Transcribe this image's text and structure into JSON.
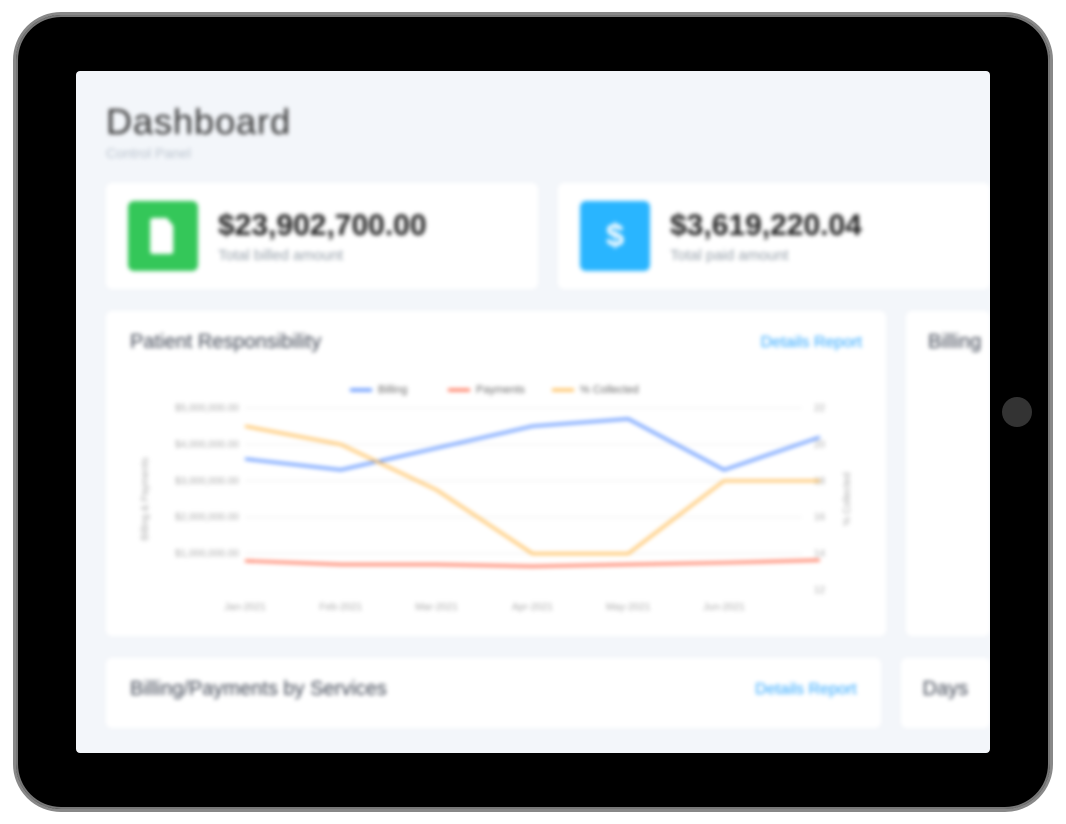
{
  "page": {
    "title": "Dashboard",
    "subtitle": "Control Panel"
  },
  "stats": [
    {
      "value": "$23,902,700.00",
      "label": "Total billed amount",
      "icon": "file-icon",
      "color": "#34c759"
    },
    {
      "value": "$3,619,220.04",
      "label": "Total paid amount",
      "icon": "dollar-icon",
      "color": "#29b5ff"
    }
  ],
  "cards": {
    "patient_responsibility": {
      "title": "Patient Responsibility",
      "link_label": "Details Report"
    },
    "billing_cut": {
      "title": "Billing"
    },
    "billing_services": {
      "title": "Billing/Payments by Services",
      "link_label": "Details Report"
    },
    "days_cut": {
      "title": "Days"
    }
  },
  "chart_data": {
    "type": "line",
    "categories": [
      "Jan-2021",
      "Feb-2021",
      "Mar-2021",
      "Apr-2021",
      "May-2021",
      "Jun-2021"
    ],
    "series": [
      {
        "name": "Billing",
        "axis": "left",
        "color": "#3a7bff",
        "values": [
          3600000,
          3300000,
          3900000,
          4500000,
          4700000,
          3300000
        ]
      },
      {
        "name": "Payments",
        "axis": "left",
        "color": "#ff5b3a",
        "values": [
          800000,
          700000,
          700000,
          650000,
          700000,
          750000
        ]
      },
      {
        "name": "% Collected",
        "axis": "right",
        "color": "#ffb23a",
        "values": [
          21,
          20,
          17.5,
          14,
          14,
          18
        ]
      }
    ],
    "ylabel_left": "Billing & Payments",
    "ylabel_right": "% Collected",
    "yticks_left": [
      "$1,000,000.00",
      "$2,000,000.00",
      "$3,000,000.00",
      "$4,000,000.00",
      "$5,000,000.00"
    ],
    "yticks_right": [
      "12",
      "14",
      "16",
      "18",
      "20",
      "22"
    ],
    "ylim_left": [
      0,
      5000000
    ],
    "ylim_right": [
      12,
      22
    ],
    "extra_point_right": {
      "x_index": 6.0,
      "value": 18
    }
  }
}
